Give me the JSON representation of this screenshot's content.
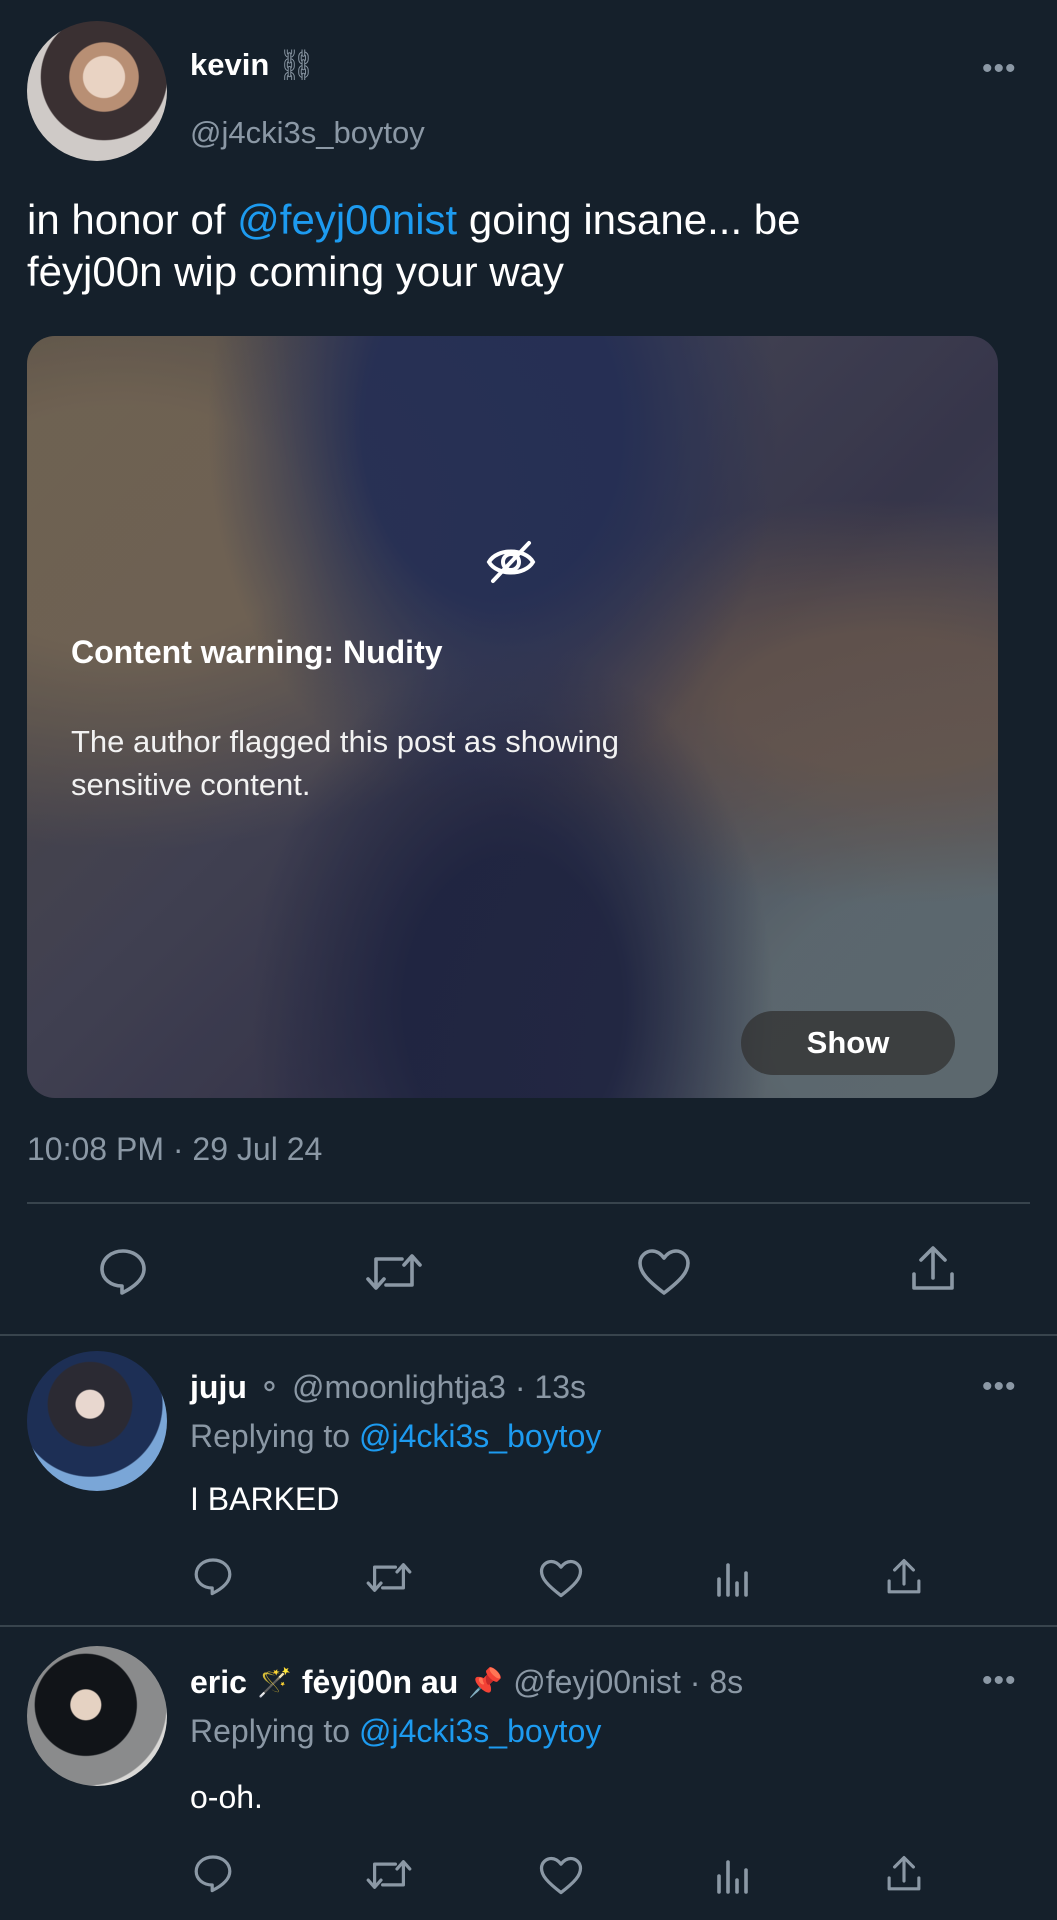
{
  "main_tweet": {
    "display_name": "kevin",
    "name_emoji": "⛓",
    "handle": "@j4cki3s_boytoy",
    "more": "•••",
    "text_part1": "in honor of ",
    "mention": "@feyj00nist",
    "text_part2": " going insane... be",
    "text_line2": "fėyj00n wip coming your way",
    "media": {
      "warning_title": "Content warning: Nudity",
      "warning_body_line1": "The author flagged this post as showing",
      "warning_body_line2": "sensitive content.",
      "show_label": "Show"
    },
    "timestamp": "10:08 PM · 29 Jul 24"
  },
  "replies": [
    {
      "display_name": "juju",
      "name_emoji": "⚬",
      "meta": "@moonlightja3 · 13s",
      "replying_prefix": "Replying to ",
      "replying_handle": "@j4cki3s_boytoy",
      "text": "I BARKED",
      "more": "•••"
    },
    {
      "display_name": "eric",
      "name_emoji": "🪄",
      "name_part2": "fėyj00n au",
      "name_emoji2": "📌",
      "meta": "@feyj00nist · 8s",
      "replying_prefix": "Replying to ",
      "replying_handle": "@j4cki3s_boytoy",
      "text": "o-oh.",
      "more": "•••"
    }
  ],
  "colors": {
    "background": "#15202b",
    "link": "#1d9bf0",
    "muted": "#8b98a5",
    "divider": "#38444d"
  }
}
